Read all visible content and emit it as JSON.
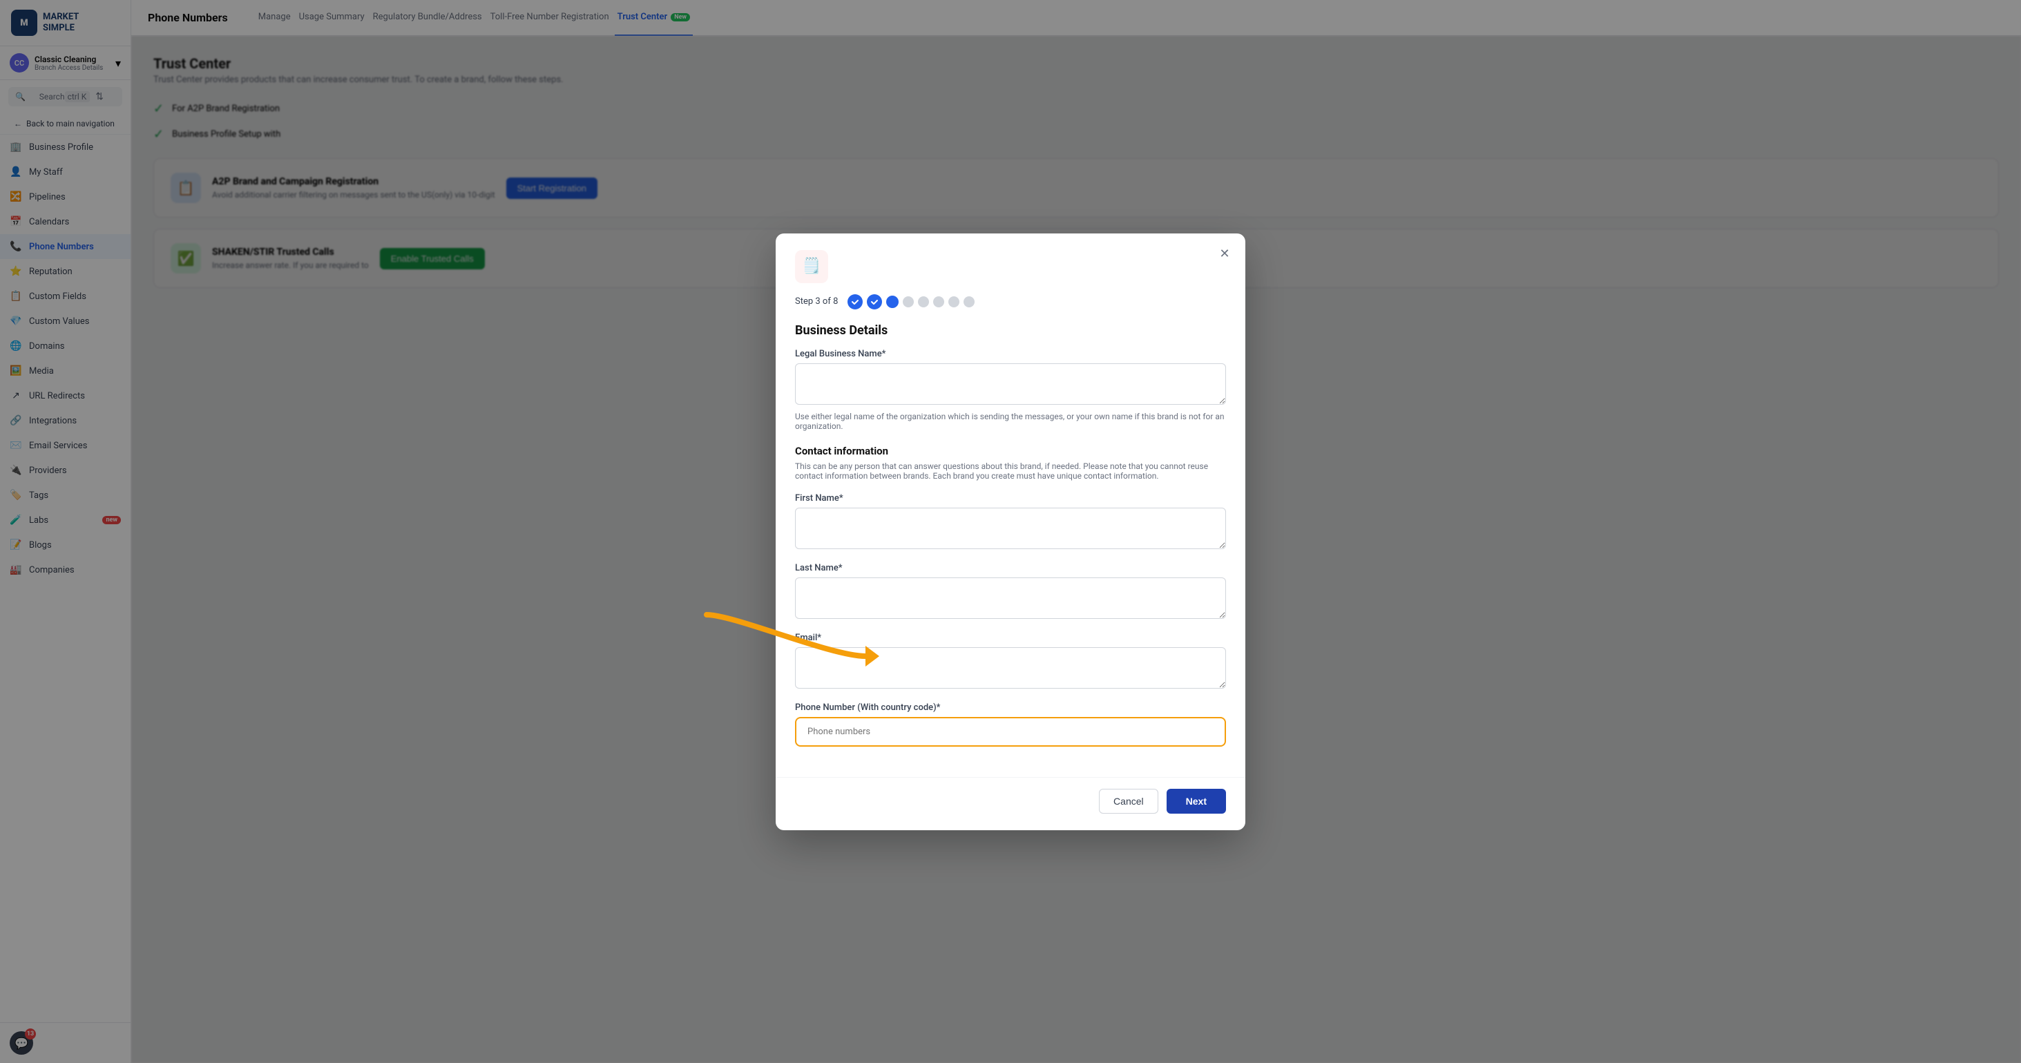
{
  "app": {
    "logo_line1": "MARKET",
    "logo_line2": "SIMPLE"
  },
  "sidebar": {
    "account_name": "Classic Cleaning",
    "account_sub": "Branch Access Details",
    "search_label": "Search",
    "search_kbd": "ctrl K",
    "back_nav": "Back to main navigation",
    "items": [
      {
        "id": "business-profile",
        "label": "Business Profile",
        "icon": "🏢",
        "active": false
      },
      {
        "id": "my-staff",
        "label": "My Staff",
        "icon": "👤",
        "active": false
      },
      {
        "id": "pipelines",
        "label": "Pipelines",
        "icon": "🔀",
        "active": false
      },
      {
        "id": "calendars",
        "label": "Calendars",
        "icon": "📅",
        "active": false
      },
      {
        "id": "phone-numbers",
        "label": "Phone Numbers",
        "icon": "📞",
        "active": true
      },
      {
        "id": "reputation",
        "label": "Reputation",
        "icon": "⭐",
        "active": false
      },
      {
        "id": "custom-fields",
        "label": "Custom Fields",
        "icon": "📋",
        "active": false
      },
      {
        "id": "custom-values",
        "label": "Custom Values",
        "icon": "💎",
        "active": false
      },
      {
        "id": "domains",
        "label": "Domains",
        "icon": "🌐",
        "active": false
      },
      {
        "id": "media",
        "label": "Media",
        "icon": "🖼️",
        "active": false
      },
      {
        "id": "url-redirects",
        "label": "URL Redirects",
        "icon": "↗",
        "active": false
      },
      {
        "id": "integrations",
        "label": "Integrations",
        "icon": "🔗",
        "active": false
      },
      {
        "id": "email-services",
        "label": "Email Services",
        "icon": "✉️",
        "active": false
      },
      {
        "id": "providers",
        "label": "Providers",
        "icon": "🔌",
        "active": false
      },
      {
        "id": "tags",
        "label": "Tags",
        "icon": "🏷️",
        "active": false
      },
      {
        "id": "labs",
        "label": "Labs",
        "icon": "🧪",
        "active": false,
        "badge": "new"
      },
      {
        "id": "blogs",
        "label": "Blogs",
        "icon": "📝",
        "active": false
      },
      {
        "id": "companies",
        "label": "Companies",
        "icon": "🏭",
        "active": false
      }
    ],
    "message_count": "13"
  },
  "topbar": {
    "title": "Phone Numbers",
    "tabs": [
      {
        "id": "manage",
        "label": "Manage",
        "active": false
      },
      {
        "id": "usage-summary",
        "label": "Usage Summary",
        "active": false
      },
      {
        "id": "regulatory-bundle",
        "label": "Regulatory Bundle/Address",
        "active": false
      },
      {
        "id": "tollfree-registration",
        "label": "Toll-Free Number Registration",
        "active": false
      },
      {
        "id": "trust-center",
        "label": "Trust Center",
        "active": true,
        "badge": "New"
      }
    ]
  },
  "modal": {
    "step_text": "Step 3 of 8",
    "steps": [
      {
        "id": 1,
        "state": "done"
      },
      {
        "id": 2,
        "state": "done"
      },
      {
        "id": 3,
        "state": "active"
      },
      {
        "id": 4,
        "state": "inactive"
      },
      {
        "id": 5,
        "state": "inactive"
      },
      {
        "id": 6,
        "state": "inactive"
      },
      {
        "id": 7,
        "state": "inactive"
      },
      {
        "id": 8,
        "state": "inactive"
      }
    ],
    "title": "Business Details",
    "legal_name_label": "Legal Business Name*",
    "legal_name_hint": "Use either legal name of the organization which is sending the messages, or your own name if this brand is not for an organization.",
    "contact_section_title": "Contact information",
    "contact_section_desc": "This can be any person that can answer questions about this brand, if needed. Please note that you cannot reuse contact information between brands. Each brand you create must have unique contact information.",
    "first_name_label": "First Name*",
    "last_name_label": "Last Name*",
    "email_label": "Email*",
    "phone_label": "Phone Number (With country code)*",
    "phone_placeholder": "Phone numbers",
    "cancel_label": "Cancel",
    "next_label": "Next"
  }
}
